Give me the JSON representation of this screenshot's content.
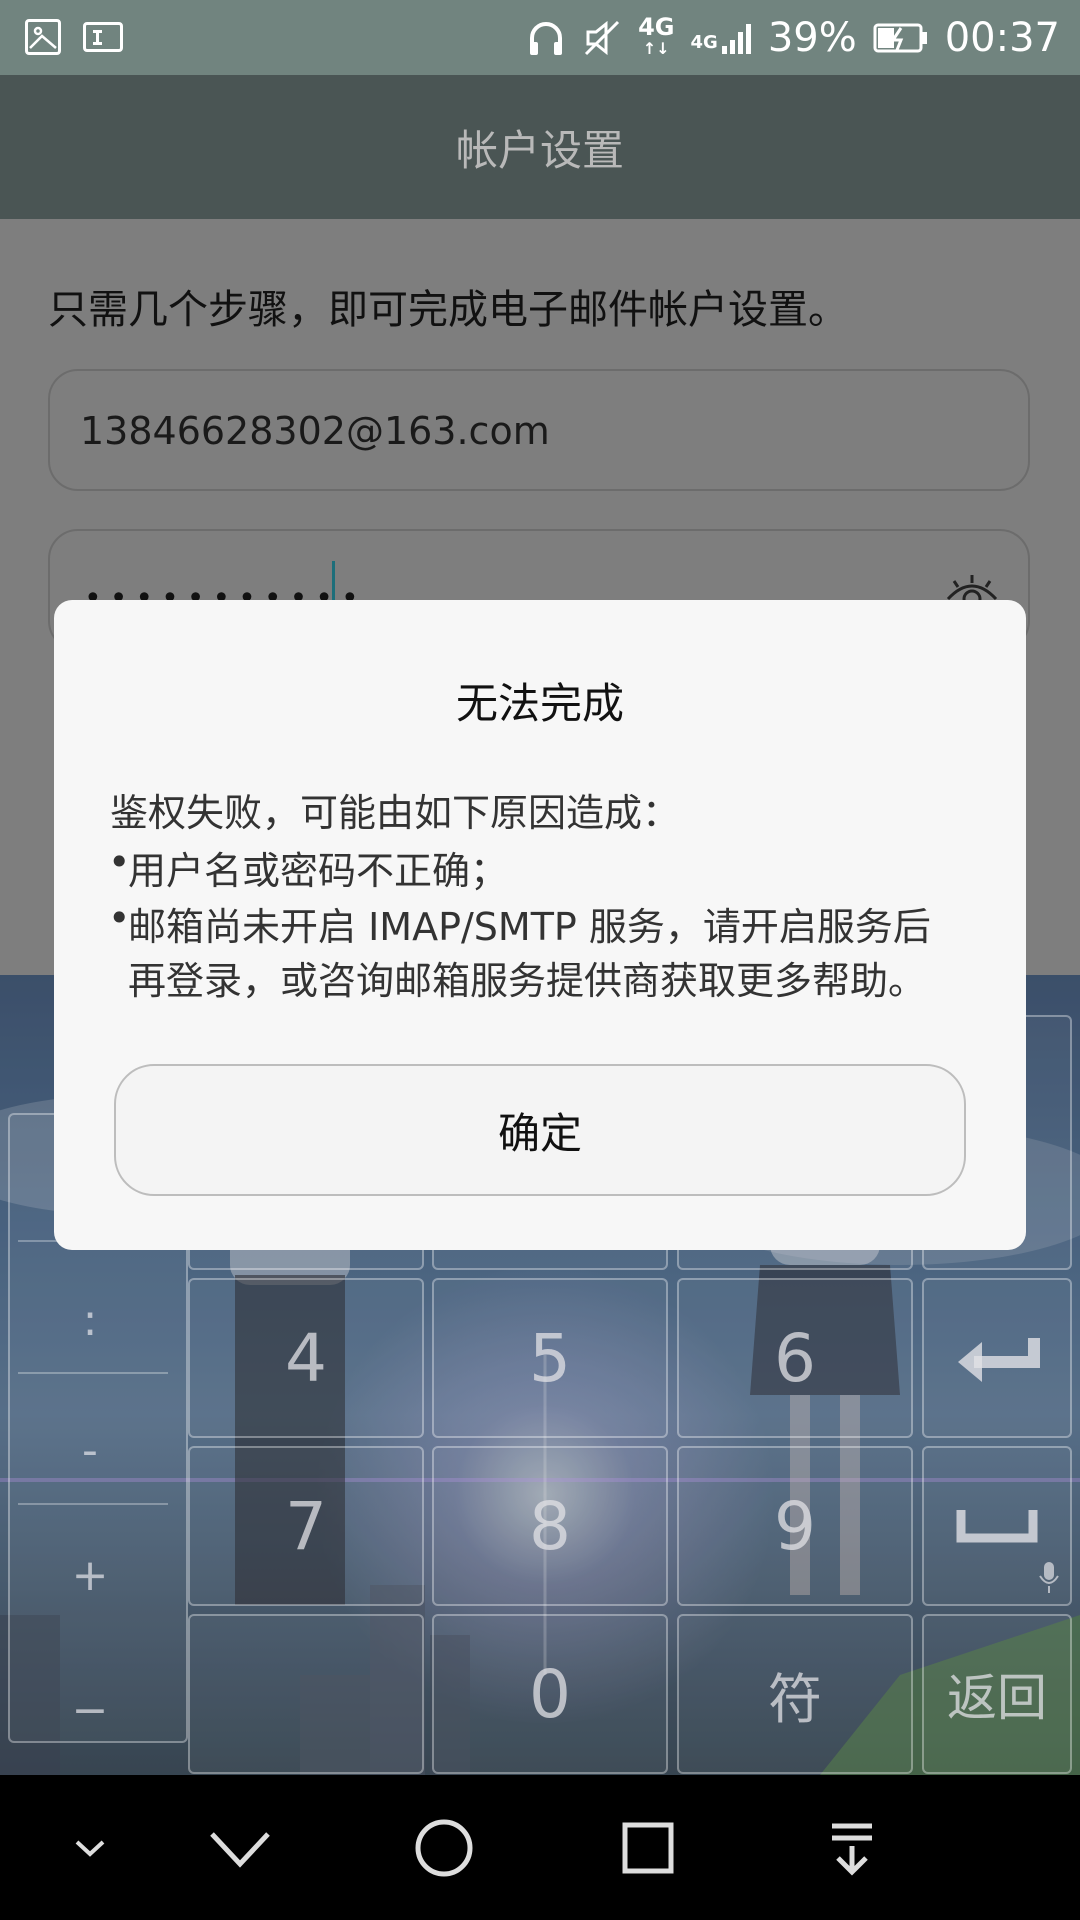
{
  "status_bar": {
    "network_1": "4G",
    "network_2": "4G",
    "battery": "39%",
    "time": "00:37",
    "icons": [
      "image-icon",
      "text-icon",
      "headphones-icon",
      "mute-icon",
      "signal-icon",
      "battery-icon"
    ]
  },
  "header": {
    "title": "帐户设置"
  },
  "form": {
    "intro": "只需几个步骤，即可完成电子邮件帐户设置。",
    "email_value": "13846628302@163.com",
    "password_mask": "•••••••••••"
  },
  "keyboard": {
    "symbols": [
      ":",
      "-",
      "+",
      "−"
    ],
    "keys": [
      "4",
      "5",
      "6",
      "7",
      "8",
      "9",
      "0",
      "符",
      "返回"
    ]
  },
  "dialog": {
    "title": "无法完成",
    "message": "鉴权失败，可能由如下原因造成：",
    "bullet": "•",
    "reason_1": "用户名或密码不正确；",
    "reason_2_line_1": "邮箱尚未开启 IMAP/SMTP 服务，请开启服务后",
    "reason_2_line_2": "再登录，或咨询邮箱服务提供商获取更多帮助。",
    "ok_label": "确定"
  },
  "navigation": {
    "icons": [
      "collapse-icon",
      "back-icon",
      "home-icon",
      "recents-icon",
      "notification-icon"
    ]
  },
  "colors": {
    "status_bar": "#71847f",
    "title_bar": "#4a5554",
    "dialog_bg": "#f7f7f7",
    "cursor": "#1d6e7a"
  }
}
